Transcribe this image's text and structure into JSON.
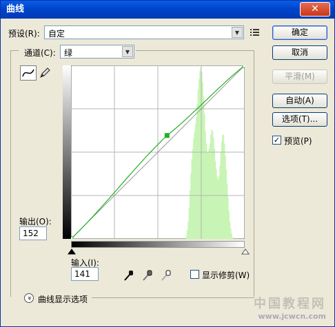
{
  "window": {
    "title": "曲线",
    "close_glyph": "✕"
  },
  "preset": {
    "label": "预设(R):",
    "value": "自定"
  },
  "channel": {
    "label": "通道(C):",
    "value": "绿"
  },
  "buttons": {
    "ok": "确定",
    "cancel": "取消",
    "smooth": "平滑(M)",
    "auto": "自动(A)",
    "options": "选项(T)..."
  },
  "preview": {
    "label": "预览(P)",
    "checked": true,
    "check_glyph": "✓"
  },
  "output": {
    "label": "输出(O):",
    "value": "152"
  },
  "input": {
    "label": "输入(I):",
    "value": "141"
  },
  "show_clipping": {
    "label": "显示修剪(W)",
    "checked": false
  },
  "display_options": {
    "label": "曲线显示选项",
    "toggle_glyph": "»"
  },
  "watermark": {
    "line1": "中国教程网",
    "line2": "www.jcwcn.com"
  },
  "curve": {
    "points": [
      [
        0,
        0
      ],
      [
        141,
        152
      ],
      [
        255,
        255
      ]
    ],
    "range": [
      0,
      255
    ],
    "grid_divisions": 4,
    "curve_color": "#22b022",
    "histogram_color": "#c8f5b5"
  },
  "histogram": [
    0,
    0,
    0,
    0,
    0,
    0,
    0,
    0,
    0,
    0,
    0,
    0,
    0,
    0,
    0,
    0,
    0,
    0,
    0,
    0,
    0,
    0,
    0,
    0,
    0,
    0,
    0,
    0,
    0,
    0,
    0,
    0,
    0,
    0,
    0,
    0,
    0,
    0,
    0,
    0,
    0,
    0,
    0,
    0,
    0,
    0,
    0,
    0,
    0,
    0,
    0,
    0,
    0,
    0,
    0,
    0,
    0,
    0,
    0,
    0,
    0,
    0,
    0,
    0,
    0,
    0,
    0,
    0,
    0,
    0,
    0,
    0,
    0,
    0,
    0,
    0,
    0,
    0,
    0,
    0,
    0,
    0,
    0,
    0,
    0,
    0,
    0,
    0,
    0,
    0,
    0,
    0,
    0,
    0,
    0,
    0,
    0,
    0,
    0,
    0,
    0,
    0,
    0,
    0,
    0,
    0,
    0,
    0,
    0,
    0,
    0,
    0,
    0,
    0,
    0,
    0,
    0,
    0,
    0,
    0,
    0,
    0,
    0,
    0,
    0,
    0,
    0,
    0.02,
    0.05,
    0.1,
    0.18,
    0.28,
    0.38,
    0.46,
    0.52,
    0.58,
    0.62,
    0.66,
    0.7,
    0.78,
    0.86,
    0.92,
    0.97,
    0.99,
    0.96,
    0.9,
    0.82,
    0.72,
    0.62,
    0.55,
    0.5,
    0.5,
    0.52,
    0.55,
    0.6,
    0.63,
    0.62,
    0.58,
    0.52,
    0.45,
    0.4,
    0.36,
    0.34,
    0.36,
    0.42,
    0.5,
    0.56,
    0.6,
    0.6,
    0.55,
    0.48,
    0.4,
    0.32,
    0.24,
    0.16,
    0.1,
    0.06,
    0.03,
    0.01,
    0,
    0,
    0,
    0,
    0,
    0,
    0,
    0,
    0,
    0,
    0,
    0,
    0
  ]
}
